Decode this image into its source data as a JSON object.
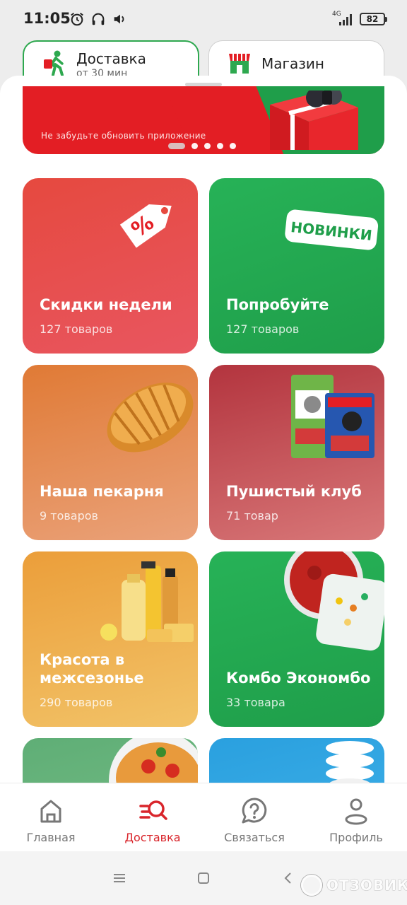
{
  "status": {
    "time": "11:05",
    "network": "4G",
    "battery": "82"
  },
  "mode_switch": {
    "delivery": {
      "title": "Доставка",
      "subtitle": "от 30 мин"
    },
    "shop": {
      "title": "Магазин"
    }
  },
  "banner": {
    "text": "Не забудьте обновить приложение",
    "slides": 5,
    "active_slide": 1
  },
  "categories": [
    {
      "title": "Скидки недели",
      "count": "127 товаров",
      "art": "discount-tag-icon"
    },
    {
      "title": "Попробуйте",
      "count": "127 товаров",
      "art": "new-sticker",
      "badge": "НОВИНКИ"
    },
    {
      "title": "Наша пекарня",
      "count": "9 товаров",
      "art": "croissant-image"
    },
    {
      "title": "Пушистый клуб",
      "count": "71 товар",
      "art": "pet-food-image"
    },
    {
      "title": "Красота в межсезонье",
      "count": "290 товаров",
      "art": "cosmetics-image"
    },
    {
      "title": "Комбо Экономбо",
      "count": "33 товара",
      "art": "food-containers-image"
    },
    {
      "title": "",
      "count": "",
      "art": "pasta-image"
    },
    {
      "title": "",
      "count": "",
      "art": "light-bulb-image"
    }
  ],
  "bottom_nav": [
    {
      "label": "Главная",
      "icon": "home-icon"
    },
    {
      "label": "Доставка",
      "icon": "delivery-search-icon",
      "active": true
    },
    {
      "label": "Связаться",
      "icon": "question-chat-icon"
    },
    {
      "label": "Профиль",
      "icon": "profile-icon"
    }
  ],
  "watermark": "ОТЗОВИК",
  "colors": {
    "brand_red": "#e31e24",
    "brand_green": "#1f9e4a",
    "active_nav": "#d9252b"
  }
}
